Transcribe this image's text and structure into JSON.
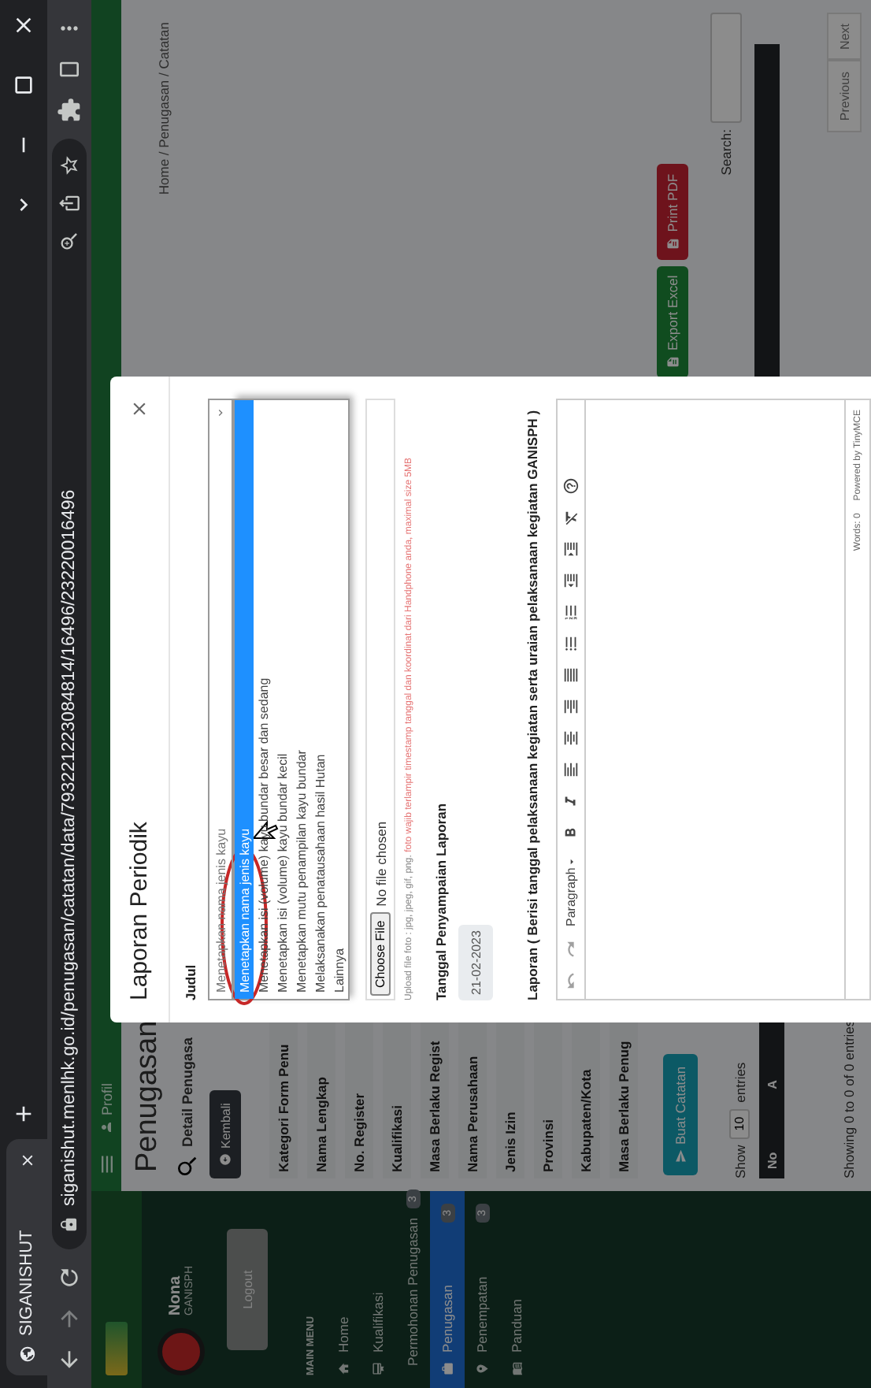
{
  "browser": {
    "tab_title": "SIGANISHUT",
    "url": "siganishut.menlhk.go.id/penugasan/catatan/data/793221223084814/16496/23220016496"
  },
  "sidebar": {
    "user_name": "Nona",
    "user_role": "GANISPH",
    "logout": "Logout",
    "menu_heading": "MAIN MENU",
    "items": [
      {
        "label": "Home",
        "kind": "home",
        "selected": false
      },
      {
        "label": "Kualifikasi",
        "kind": "qualification",
        "selected": false
      },
      {
        "label": "Permohonan Penugasan",
        "kind": "request",
        "badge": "3",
        "selected": false
      },
      {
        "label": "Penugasan",
        "kind": "assignment",
        "badge": "3",
        "selected": true
      },
      {
        "label": "Penempatan",
        "kind": "placement",
        "badge": "3",
        "selected": false
      },
      {
        "label": "Panduan",
        "kind": "guide",
        "selected": false
      }
    ]
  },
  "navbar": {
    "profile": "Profil"
  },
  "page": {
    "title": "Penugasan",
    "breadcrumb": "Home / Penugasan / Catatan",
    "detail_heading": "Detail Penugasa",
    "back_button": "Kembali",
    "fields": [
      "Kategori Form Penu",
      "Nama Lengkap",
      "No. Register",
      "Kualifikasi",
      "Masa Berlaku Regist",
      "Nama Perusahaan",
      "Jenis Izin",
      "Provinsi",
      "Kabupaten/Kota",
      "Masa Berlaku Penug"
    ],
    "create_button": "Buat Catatan",
    "export_buttons": [
      {
        "label": "Export Excel",
        "kind": "excel"
      },
      {
        "label": "Print PDF",
        "kind": "pdf"
      }
    ],
    "show_label": "Show",
    "page_size": "10",
    "entries_label": "entries",
    "search_label": "Search:",
    "columns": [
      "No",
      "A"
    ],
    "info": "Showing 0 to 0 of 0 entries",
    "pager": [
      "Previous",
      "Next"
    ]
  },
  "modal": {
    "title": "Laporan Periodik",
    "judul_label": "Judul",
    "judul_value": "Menetapkan nama jenis kayu",
    "options": [
      {
        "label": "Menetapkan nama jenis kayu",
        "selected": true
      },
      {
        "label": "Menetapkan isi (volume) kayu bundar besar dan sedang",
        "selected": false
      },
      {
        "label": "Menetapkan isi (volume) kayu bundar kecil",
        "selected": false
      },
      {
        "label": "Menetapkan mutu penampilan kayu bundar",
        "selected": false
      },
      {
        "label": "Melaksanakan penatausahaan hasil Hutan",
        "selected": false
      },
      {
        "label": "Lainnya",
        "selected": false
      }
    ],
    "file_button": "Choose File",
    "file_status": "No file chosen",
    "hint_format": "Upload file foto : jpg, jpeg, gif, png.",
    "hint_warning": "foto wajib terlampir timestamp tanggal dan koordinat dari Handphone anda, maximal size 5MB",
    "date_label": "Tanggal Penyampaian Laporan",
    "date_value": "21-02-2023",
    "report_label": "Laporan ( Berisi tanggal pelaksanaan kegiatan serta uraian pelaksanaan kegiatan GANISPH )",
    "block_format": "Paragraph",
    "powered_by": "Powered by TinyMCE",
    "word_count": "Words: 0"
  }
}
